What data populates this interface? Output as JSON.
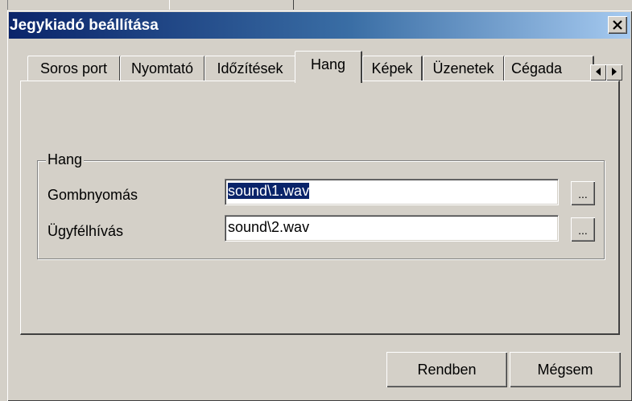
{
  "window": {
    "title": "Jegykiadó beállítása",
    "close_label": "✕"
  },
  "tabs": [
    {
      "label": "Soros port",
      "active": false
    },
    {
      "label": "Nyomtató",
      "active": false
    },
    {
      "label": "Időzítések",
      "active": false
    },
    {
      "label": "Hang",
      "active": true
    },
    {
      "label": "Képek",
      "active": false
    },
    {
      "label": "Üzenetek",
      "active": false
    },
    {
      "label": "Cégada",
      "active": false
    }
  ],
  "tab_scroll": {
    "left_icon": "arrow-left-icon",
    "right_icon": "arrow-right-icon"
  },
  "sound_group": {
    "legend": "Hang",
    "fields": [
      {
        "label": "Gombnyomás",
        "value": "sound\\1.wav",
        "browse_label": "...",
        "selected": true
      },
      {
        "label": "Ügyfélhívás",
        "value": "sound\\2.wav",
        "browse_label": "...",
        "selected": false
      }
    ]
  },
  "buttons": {
    "ok_label": "Rendben",
    "cancel_label": "Mégsem"
  },
  "colors": {
    "title_start": "#0a246a",
    "title_end": "#a6caf0",
    "face": "#d4d0c8",
    "selection": "#0a246a"
  }
}
